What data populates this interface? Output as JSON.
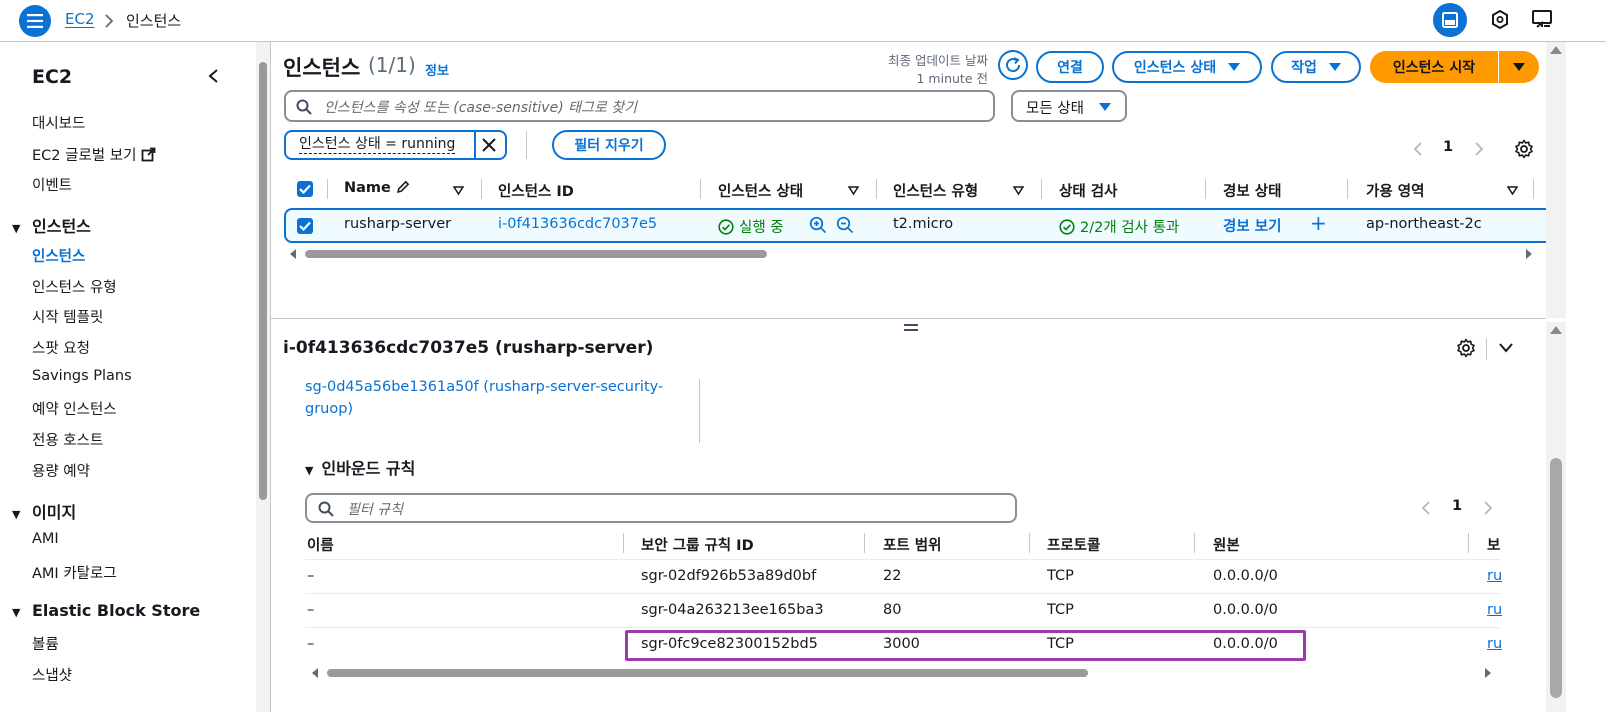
{
  "topbar": {
    "breadcrumb_root": "EC2",
    "breadcrumb_current": "인스턴스"
  },
  "sidebar": {
    "title": "EC2",
    "items_top": [
      "대시보드",
      "EC2 글로벌 보기",
      "이벤트"
    ],
    "sections": [
      {
        "label": "인스턴스",
        "items": [
          "인스턴스",
          "인스턴스 유형",
          "시작 템플릿",
          "스팟 요청",
          "Savings Plans",
          "예약 인스턴스",
          "전용 호스트",
          "용량 예약"
        ]
      },
      {
        "label": "이미지",
        "items": [
          "AMI",
          "AMI 카탈로그"
        ]
      },
      {
        "label": "Elastic Block Store",
        "items": [
          "볼륨",
          "스냅샷"
        ]
      }
    ]
  },
  "instances": {
    "title": "인스턴스",
    "count": "(1/1)",
    "info": "정보",
    "last_update_label": "최종 업데이트 날짜",
    "last_update_value": "1 minute 전",
    "btn_connect": "연결",
    "btn_state": "인스턴스 상태",
    "btn_actions": "작업",
    "btn_launch": "인스턴스 시작",
    "search_placeholder": "인스턴스를 속성 또는 (case-sensitive) 태그로 찾기",
    "state_filter": "모든 상태",
    "token": "인스턴스 상태 = running",
    "clear_filters": "필터 지우기",
    "page": "1",
    "columns": [
      "Name",
      "인스턴스 ID",
      "인스턴스 상태",
      "인스턴스 유형",
      "상태 검사",
      "경보 상태",
      "가용 영역"
    ],
    "row": {
      "name": "rusharp-server",
      "id": "i-0f413636cdc7037e5",
      "state": "실행 중",
      "type": "t2.micro",
      "check": "2/2개 검사 통과",
      "alarm": "경보 보기",
      "alarm_add": "+",
      "az": "ap-northeast-2c"
    }
  },
  "details": {
    "title": "i-0f413636cdc7037e5 (rusharp-server)",
    "sg_link": "sg-0d45a56be1361a50f (rusharp-server-security-gruop)",
    "inbound_title": "인바운드 규칙",
    "filter_placeholder": "필터 규칙",
    "page": "1",
    "columns": [
      "이름",
      "보안 그룹 규칙 ID",
      "포트 범위",
      "프로토콜",
      "원본",
      "보"
    ],
    "rules": [
      {
        "name": "–",
        "id": "sgr-02df926b53a89d0bf",
        "port": "22",
        "protocol": "TCP",
        "source": "0.0.0.0/0",
        "more": "ru"
      },
      {
        "name": "–",
        "id": "sgr-04a263213ee165ba3",
        "port": "80",
        "protocol": "TCP",
        "source": "0.0.0.0/0",
        "more": "ru"
      },
      {
        "name": "–",
        "id": "sgr-0fc9ce82300152bd5",
        "port": "3000",
        "protocol": "TCP",
        "source": "0.0.0.0/0",
        "more": "ru"
      }
    ]
  },
  "colors": {
    "accent": "#0972d3",
    "orange": "#ff9900",
    "success": "#037f0c",
    "highlight": "#9b3ca8"
  }
}
